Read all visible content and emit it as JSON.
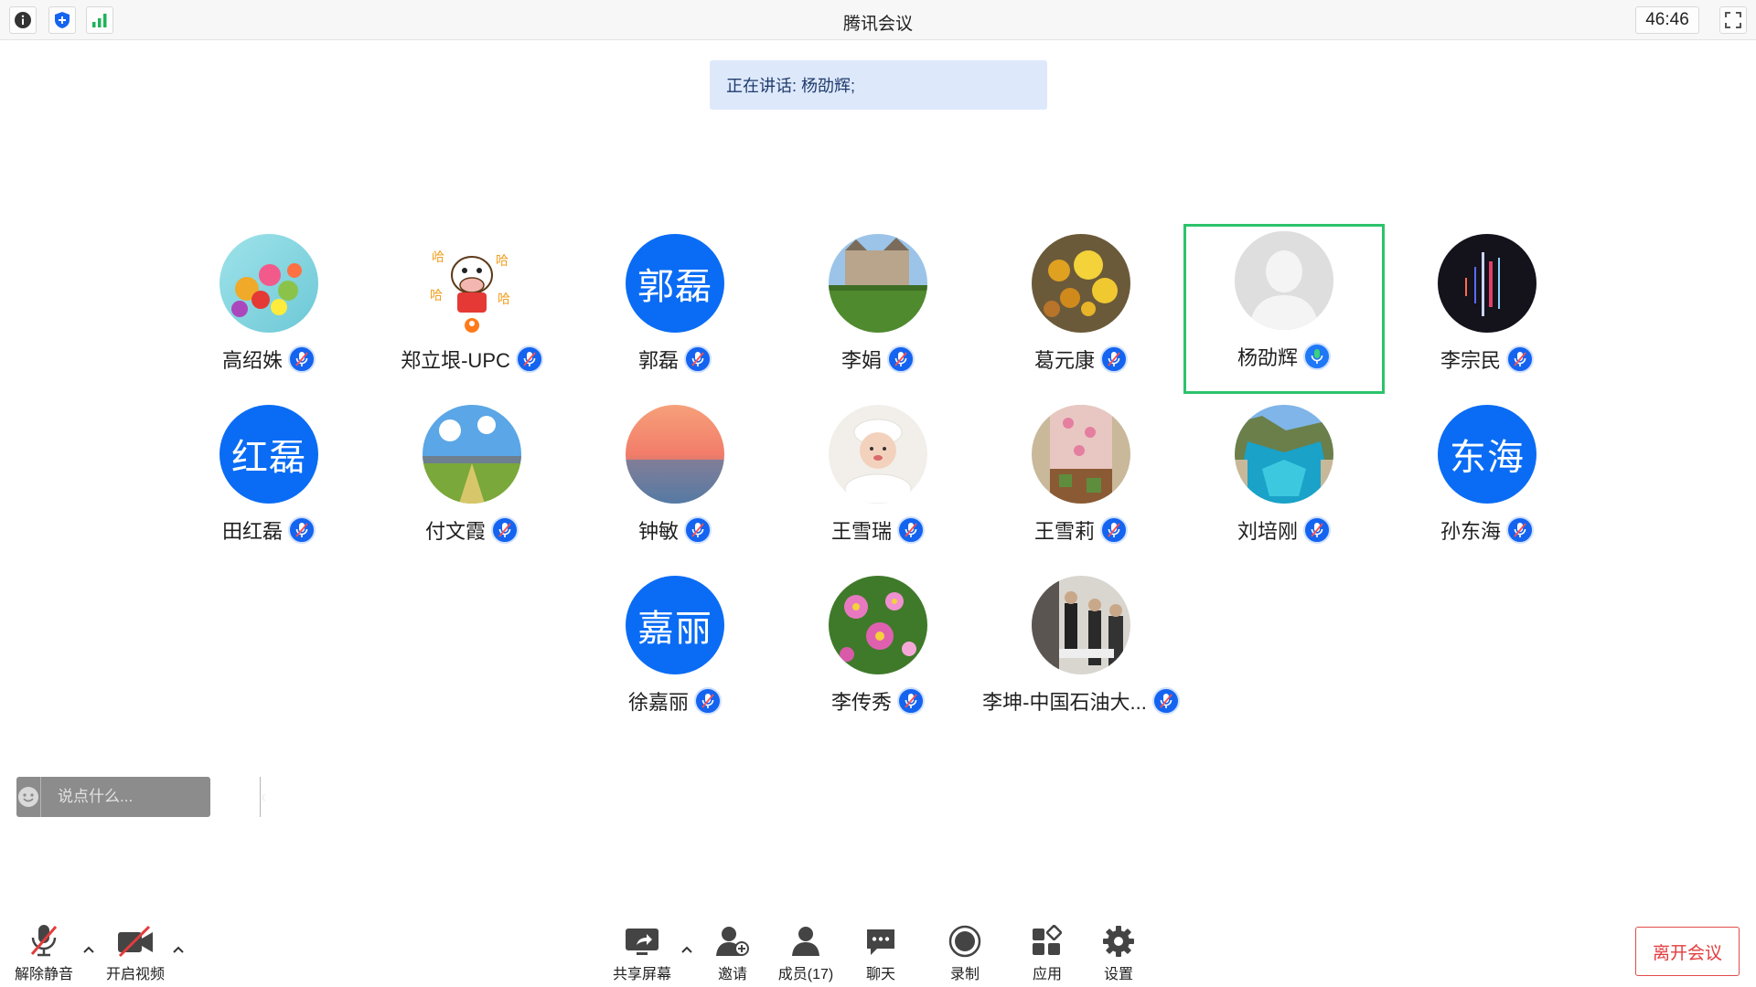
{
  "window": {
    "title": "腾讯会议",
    "timer": "46:46"
  },
  "speaking": {
    "text": "正在讲话: 杨劭辉;"
  },
  "participants": [
    {
      "name": "高绍姝",
      "avatar": "photo",
      "mic": "muted"
    },
    {
      "name": "郑立垠-UPC",
      "avatar": "photo",
      "mic": "muted"
    },
    {
      "name": "郭磊",
      "avatar_text": "郭磊",
      "mic": "muted"
    },
    {
      "name": "李娟",
      "avatar": "photo",
      "mic": "muted"
    },
    {
      "name": "葛元康",
      "avatar": "photo",
      "mic": "muted"
    },
    {
      "name": "杨劭辉",
      "avatar": "default",
      "mic": "speaking",
      "active": true
    },
    {
      "name": "李宗民",
      "avatar": "photo",
      "mic": "muted"
    },
    {
      "name": "田红磊",
      "avatar_text": "红磊",
      "mic": "muted"
    },
    {
      "name": "付文霞",
      "avatar": "photo",
      "mic": "muted"
    },
    {
      "name": "钟敏",
      "avatar": "photo",
      "mic": "muted"
    },
    {
      "name": "王雪瑞",
      "avatar": "photo",
      "mic": "muted"
    },
    {
      "name": "王雪莉",
      "avatar": "photo",
      "mic": "muted"
    },
    {
      "name": "刘培刚",
      "avatar": "photo",
      "mic": "muted"
    },
    {
      "name": "孙东海",
      "avatar_text": "东海",
      "mic": "muted"
    },
    {
      "name": "徐嘉丽",
      "avatar_text": "嘉丽",
      "mic": "muted"
    },
    {
      "name": "李传秀",
      "avatar": "photo",
      "mic": "muted"
    },
    {
      "name": "李坤-中国石油大...",
      "avatar": "photo",
      "mic": "muted"
    }
  ],
  "chat": {
    "placeholder": "说点什么..."
  },
  "toolbar": {
    "unmute": "解除静音",
    "start_video": "开启视频",
    "share_screen": "共享屏幕",
    "invite": "邀请",
    "members": "成员(17)",
    "chat": "聊天",
    "record": "录制",
    "apps": "应用",
    "settings": "设置",
    "leave": "离开会议"
  },
  "colors": {
    "accent": "#0a6cf5",
    "speaking_border": "#2cc36b",
    "leave": "#e23c3c"
  }
}
